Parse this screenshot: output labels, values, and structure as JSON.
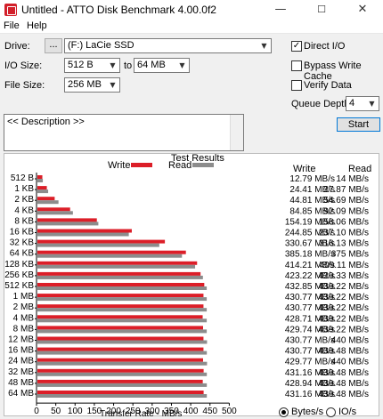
{
  "window": {
    "title": "Untitled - ATTO Disk Benchmark 4.00.0f2",
    "min": "—",
    "max": "☐",
    "close": "✕"
  },
  "menu": {
    "file": "File",
    "help": "Help"
  },
  "drive": {
    "label": "Drive:",
    "browse": "...",
    "value": "(F:) LaCie SSD"
  },
  "io_size": {
    "label": "I/O Size:",
    "from": "512 B",
    "to_label": "to",
    "to": "64 MB"
  },
  "file_size": {
    "label": "File Size:",
    "value": "256 MB"
  },
  "options": {
    "direct_io": "Direct I/O",
    "bypass_cache": "Bypass Write Cache",
    "verify": "Verify Data",
    "queue_label": "Queue Depth:",
    "queue_value": "4"
  },
  "start_label": "Start",
  "description": "<< Description >>",
  "colors": {
    "write": "#dc1e28",
    "read": "#8c8c8c"
  },
  "results": {
    "title": "Test Results",
    "write_legend": "Write",
    "read_legend": "Read",
    "write_header": "Write",
    "read_header": "Read"
  },
  "chart_data": {
    "type": "bar",
    "title": "Test Results",
    "xlabel": "Transfer Rate - MB/s",
    "x_ticks": [
      "0",
      "50",
      "100",
      "150",
      "200",
      "250",
      "300",
      "350",
      "400",
      "450",
      "500"
    ],
    "xlim": [
      0,
      500
    ],
    "categories": [
      "512 B",
      "1 KB",
      "2 KB",
      "4 KB",
      "8 KB",
      "16 KB",
      "32 KB",
      "64 KB",
      "128 KB",
      "256 KB",
      "512 KB",
      "1 MB",
      "2 MB",
      "4 MB",
      "8 MB",
      "12 MB",
      "16 MB",
      "24 MB",
      "32 MB",
      "48 MB",
      "64 MB"
    ],
    "series": [
      {
        "name": "Write",
        "values": [
          12.79,
          24.41,
          44.81,
          84.85,
          154.19,
          244.85,
          330.67,
          385.18,
          414.21,
          423.22,
          432.85,
          430.77,
          430.77,
          428.71,
          429.74,
          430.77,
          430.77,
          429.77,
          431.16,
          428.94,
          431.16
        ],
        "labels": [
          "12.79 MB/s",
          "24.41 MB/s",
          "44.81 MB/s",
          "84.85 MB/s",
          "154.19 MB/s",
          "244.85 MB/s",
          "330.67 MB/s",
          "385.18 MB/s",
          "414.21 MB/s",
          "423.22 MB/s",
          "432.85 MB/s",
          "430.77 MB/s",
          "430.77 MB/s",
          "428.71 MB/s",
          "429.74 MB/s",
          "430.77 MB/s",
          "430.77 MB/s",
          "429.77 MB/s",
          "431.16 MB/s",
          "428.94 MB/s",
          "431.16 MB/s"
        ]
      },
      {
        "name": "Read",
        "values": [
          14,
          27.87,
          54.69,
          92.09,
          158.06,
          237.1,
          316.13,
          375,
          409.11,
          429.33,
          439.22,
          439.22,
          439.22,
          439.22,
          439.22,
          440,
          439.48,
          440,
          439.48,
          439.48,
          439.48
        ],
        "labels": [
          "14 MB/s",
          "27.87 MB/s",
          "54.69 MB/s",
          "92.09 MB/s",
          "158.06 MB/s",
          "237.10 MB/s",
          "316.13 MB/s",
          "375 MB/s",
          "409.11 MB/s",
          "429.33 MB/s",
          "439.22 MB/s",
          "439.22 MB/s",
          "439.22 MB/s",
          "439.22 MB/s",
          "439.22 MB/s",
          "440 MB/s",
          "439.48 MB/s",
          "440 MB/s",
          "439.48 MB/s",
          "439.48 MB/s",
          "439.48 MB/s"
        ]
      }
    ]
  },
  "units": {
    "bytes": "Bytes/s",
    "ios": "IO/s"
  }
}
